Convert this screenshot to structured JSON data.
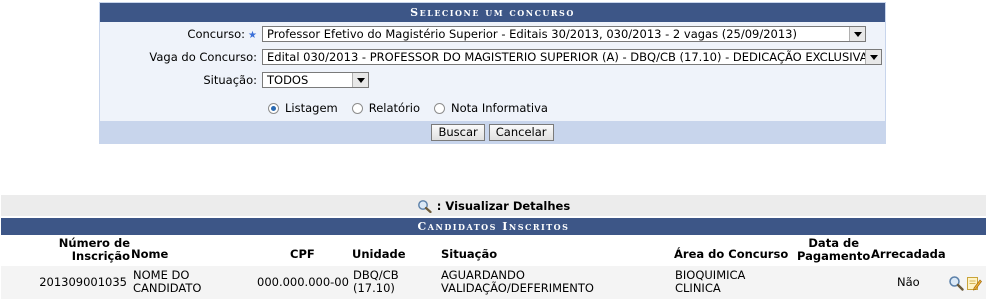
{
  "form": {
    "title": "Selecione um concurso",
    "concurso_label": "Concurso:",
    "concurso_value": "Professor Efetivo do Magistério Superior - Editais 30/2013, 030/2013 - 2 vagas (25/09/2013)",
    "vaga_label": "Vaga do Concurso:",
    "vaga_value": "Edital 030/2013 - PROFESSOR DO MAGISTERIO SUPERIOR (A) - DBQ/CB (17.10) - DEDICAÇÃO EXCLUSIVA",
    "situacao_label": "Situação:",
    "situacao_value": "TODOS",
    "radio_options": [
      "Listagem",
      "Relatório",
      "Nota Informativa"
    ],
    "selected_option": "Listagem",
    "buscar_label": "Buscar",
    "cancelar_label": "Cancelar"
  },
  "legend": {
    "text": ": Visualizar Detalhes"
  },
  "table": {
    "title": "Candidatos Inscritos",
    "headers": {
      "numero_line1": "Número de",
      "numero_line2": "Inscrição",
      "nome": "Nome",
      "cpf": "CPF",
      "unidade": "Unidade",
      "situacao": "Situação",
      "area": "Área do Concurso",
      "pagamento_line1": "Data de",
      "pagamento_line2": "Pagamento",
      "arrecadada": "Arrecadada"
    },
    "rows": [
      {
        "numero": "201309001035",
        "nome_line1": "NOME DO",
        "nome_line2": "CANDIDATO",
        "cpf": "000.000.000-00",
        "unidade_line1": "DBQ/CB",
        "unidade_line2": "(17.10)",
        "situacao_line1": "AGUARDANDO",
        "situacao_line2": "VALIDAÇÃO/DEFERIMENTO",
        "area_line1": "BIOQUIMICA",
        "area_line2": "CLINICA",
        "pagamento": "",
        "arrecadada": "Não"
      }
    ]
  },
  "colors": {
    "header_dark": "#3d5687",
    "panel_light": "#c8d5ec",
    "panel_bg": "#eff3fa"
  }
}
